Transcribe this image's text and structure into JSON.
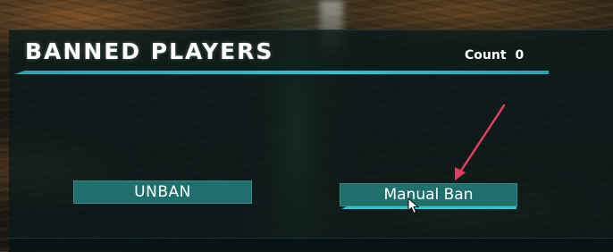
{
  "panel": {
    "title": "BANNED PLAYERS",
    "count_label": "Count",
    "count_value": "0"
  },
  "buttons": {
    "unban_label": "UNBAN",
    "manual_ban_label": "Manual Ban"
  },
  "colors": {
    "accent": "#27c7d2",
    "button_bg": "#1f6f6d",
    "arrow": "#e0405f"
  },
  "icons": {
    "annotation": "arrow-annotation-icon",
    "pointer": "mouse-cursor-icon"
  }
}
